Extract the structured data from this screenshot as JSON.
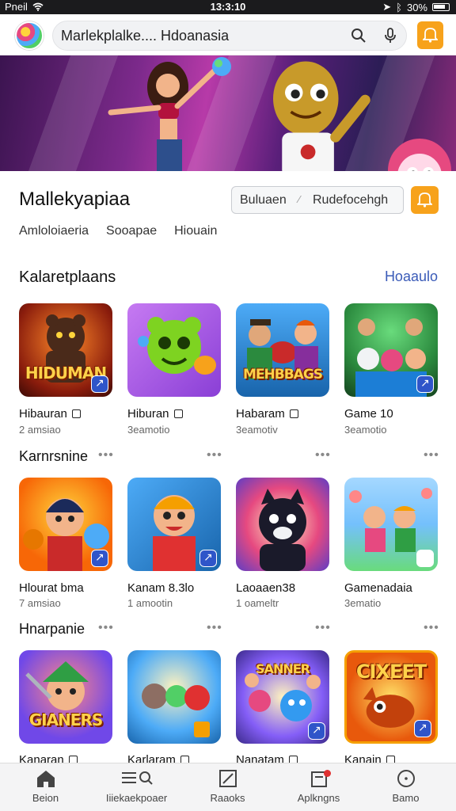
{
  "status_bar": {
    "carrier": "Pneil",
    "time": "13:3:10",
    "battery": "30%"
  },
  "search": {
    "placeholder": "Marlekplalke.... Hdoanasia"
  },
  "page": {
    "title": "Mallekyapiaa",
    "segment_left": "Buluaen",
    "segment_sep": "∕",
    "segment_right": "Rudefocehgh",
    "filters": [
      "Amloloiaeria",
      "Sooapae",
      "Hiouain"
    ]
  },
  "sections": [
    {
      "title": "Kalaretplaans",
      "see_all": "Hoaaulo",
      "games": [
        {
          "name": "Hibauran",
          "sub": "2 amsiao",
          "art": "HIDUMAN",
          "lock": true
        },
        {
          "name": "Hiburan",
          "sub": "3eamotio",
          "art": "",
          "lock": true
        },
        {
          "name": "Habaram",
          "sub": "3eamotiv",
          "art": "MEHBBAGS",
          "lock": true
        },
        {
          "name": "Game 10",
          "sub": "3eamotio",
          "art": "",
          "lock": false
        }
      ]
    },
    {
      "title": "Karnrsnine",
      "dots": "•••",
      "games": [
        {
          "name": "Hlourat bma",
          "sub": "7 amsiao",
          "art": "",
          "lock": false
        },
        {
          "name": "Kanam 8.3lo",
          "sub": "1 amootin",
          "art": "",
          "lock": false
        },
        {
          "name": "Laoaaen38",
          "sub": "1 oameltr",
          "art": "",
          "lock": false
        },
        {
          "name": "Gamenadaia",
          "sub": "3ematio",
          "art": "",
          "lock": false
        }
      ]
    },
    {
      "title": "Hnarpanie",
      "dots": "•••",
      "games": [
        {
          "name": "Kanaran",
          "sub": "",
          "art": "GIANERS",
          "lock": true
        },
        {
          "name": "Karlaram",
          "sub": "",
          "art": "",
          "lock": true
        },
        {
          "name": "Nanatam",
          "sub": "",
          "art": "SANNER",
          "lock": true
        },
        {
          "name": "Kanain",
          "sub": "",
          "art": "CIXEET",
          "lock": true
        }
      ]
    }
  ],
  "bottom_nav": [
    {
      "label": "Beion",
      "icon": "home-icon"
    },
    {
      "label": "Iiiekaekpoaer",
      "icon": "search-list-icon"
    },
    {
      "label": "Raaoks",
      "icon": "edit-icon"
    },
    {
      "label": "Aplkngns",
      "icon": "apps-icon"
    },
    {
      "label": "Bamo",
      "icon": "profile-circle-icon"
    }
  ],
  "colors": {
    "accent_orange": "#f7a21b",
    "link_blue": "#3a5bb8",
    "badge_blue": "#2f55c9"
  }
}
